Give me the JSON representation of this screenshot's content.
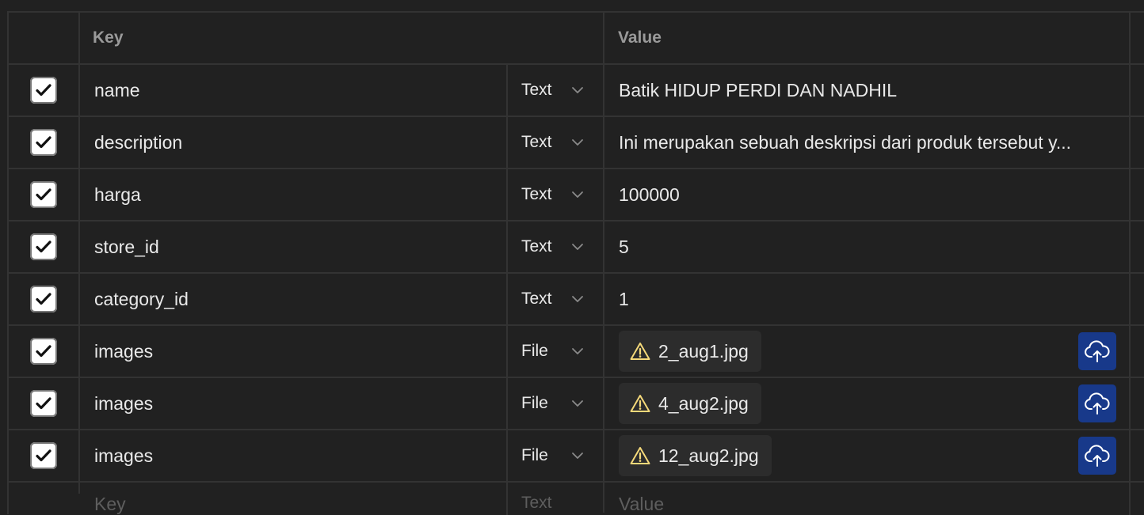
{
  "header": {
    "key": "Key",
    "value": "Value"
  },
  "rows": [
    {
      "checked": true,
      "key": "name",
      "type": "Text",
      "value": "Batik HIDUP PERDI DAN NADHIL"
    },
    {
      "checked": true,
      "key": "description",
      "type": "Text",
      "value": "Ini merupakan sebuah deskripsi dari produk tersebut y..."
    },
    {
      "checked": true,
      "key": "harga",
      "type": "Text",
      "value": "100000"
    },
    {
      "checked": true,
      "key": "store_id",
      "type": "Text",
      "value": "5"
    },
    {
      "checked": true,
      "key": "category_id",
      "type": "Text",
      "value": "1"
    },
    {
      "checked": true,
      "key": "images",
      "type": "File",
      "file": "2_aug1.jpg",
      "file_icon": "warning-icon"
    },
    {
      "checked": true,
      "key": "images",
      "type": "File",
      "file": "4_aug2.jpg",
      "file_icon": "warning-icon"
    },
    {
      "checked": true,
      "key": "images",
      "type": "File",
      "file": "12_aug2.jpg",
      "file_icon": "warning-icon"
    }
  ],
  "new_row": {
    "key_placeholder": "Key",
    "type": "Text",
    "value_placeholder": "Value"
  },
  "colors": {
    "background": "#212121",
    "border": "#333333",
    "upload_button": "#18398a",
    "warning": "#f5d97a"
  }
}
